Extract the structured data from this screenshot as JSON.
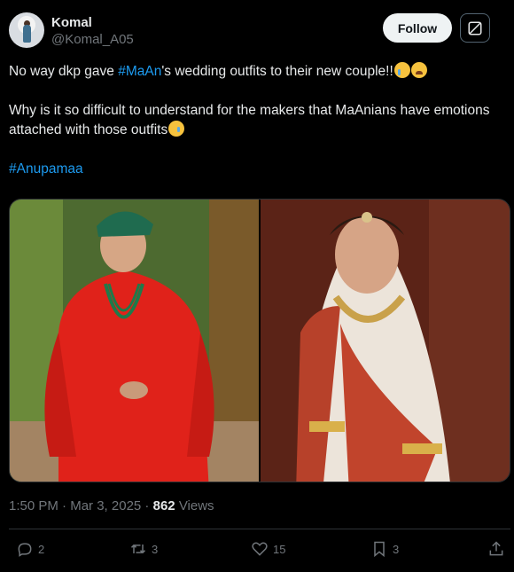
{
  "author": {
    "name": "Komal",
    "handle": "@Komal_A05"
  },
  "header": {
    "follow_label": "Follow",
    "grok_icon": "grok-icon"
  },
  "tweet": {
    "line1_pre": "No way dkp gave ",
    "line1_tag": "#MaAn",
    "line1_post": "'s wedding outfits to their new couple!!",
    "line2": " Why is it so difficult to understand for the makers that MaAnians have emotions attached with those outfits",
    "hashtag": "#Anupamaa"
  },
  "meta": {
    "time": "1:50 PM",
    "separator": " · ",
    "date": "Mar 3, 2025",
    "views_count": "862",
    "views_label": "Views"
  },
  "actions": {
    "replies": "2",
    "reposts": "3",
    "likes": "15",
    "bookmarks": "3"
  },
  "colors": {
    "accent": "#1d9bf0",
    "background": "#000000",
    "muted": "#71767b"
  }
}
